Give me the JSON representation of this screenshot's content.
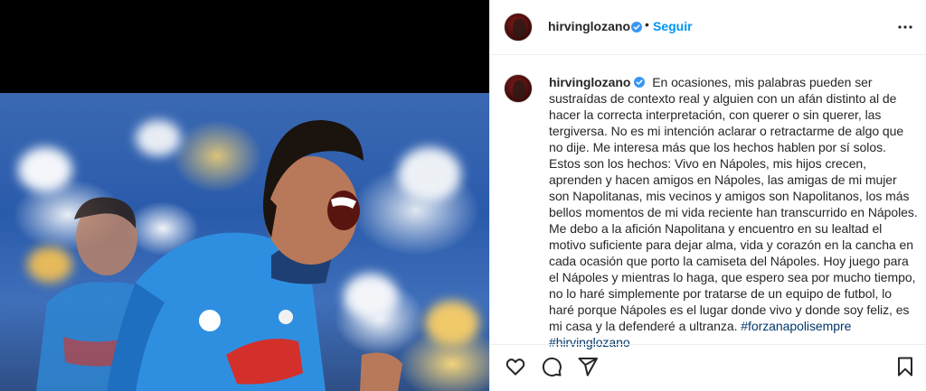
{
  "post": {
    "username": "hirvinglozano",
    "follow_label": "Seguir",
    "separator": "•",
    "caption_text": "En ocasiones, mis palabras pueden ser sustraídas de contexto real y alguien con un afán distinto al de hacer la correcta interpretación, con querer o sin querer, las tergiversa. No es mi intención aclarar o retractarme de algo que no dije. Me interesa más que los hechos hablen por sí solos. Estos son los hechos: Vivo en Nápoles, mis hijos crecen, aprenden y hacen amigos en Nápoles, las amigas de mi mujer son Napolitanas, mis vecinos y amigos son Napolitanos, los más bellos momentos de mi vida reciente han transcurrido en Nápoles. Me debo a la afición Napolitana y encuentro en su lealtad el motivo suficiente para dejar alma, vida y corazón en la cancha en cada ocasión que porto la camiseta del Nápoles. Hoy juego para el Nápoles y mientras lo haga, que espero sea por mucho tiempo, no lo haré simplemente por tratarse de un equipo de futbol, lo haré porque Nápoles es el lugar donde vivo y donde soy feliz, es mi casa y la defenderé a ultranza.",
    "hashtags": [
      "#forzanapolisempre",
      "#hirvinglozano"
    ]
  },
  "icons": {
    "verified": "verified-badge-icon",
    "more": "more-options-icon",
    "like": "heart-icon",
    "comment": "comment-icon",
    "share": "share-icon",
    "save": "bookmark-icon"
  },
  "colors": {
    "link_blue": "#0095f6",
    "hashtag": "#00376b",
    "verified": "#3897f0",
    "jersey": "#2e8fe0",
    "sponsor_red": "#d3302c"
  }
}
